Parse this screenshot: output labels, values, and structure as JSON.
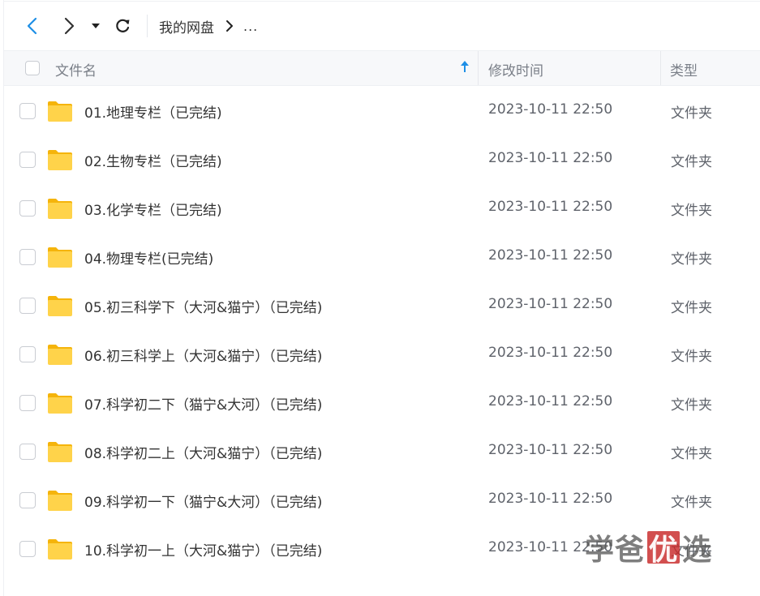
{
  "toolbar": {
    "back_icon": "chevron-left-icon",
    "forward_icon": "chevron-right-icon",
    "history_icon": "caret-down-icon",
    "refresh_icon": "refresh-icon",
    "accent_color": "#1e8fe6"
  },
  "breadcrumb": {
    "root": "我的网盘",
    "more": "..."
  },
  "table": {
    "columns": {
      "name": "文件名",
      "modified": "修改时间",
      "type": "类型"
    },
    "sort_icon": "arrow-up-icon",
    "rows": [
      {
        "name": "01.地理专栏（已完结)",
        "modified": "2023-10-11 22:50",
        "type": "文件夹"
      },
      {
        "name": "02.生物专栏（已完结)",
        "modified": "2023-10-11 22:50",
        "type": "文件夹"
      },
      {
        "name": "03.化学专栏（已完结)",
        "modified": "2023-10-11 22:50",
        "type": "文件夹"
      },
      {
        "name": "04.物理专栏(已完结)",
        "modified": "2023-10-11 22:50",
        "type": "文件夹"
      },
      {
        "name": "05.初三科学下（大河&猫宁）（已完结)",
        "modified": "2023-10-11 22:50",
        "type": "文件夹"
      },
      {
        "name": "06.初三科学上（大河&猫宁）（已完结)",
        "modified": "2023-10-11 22:50",
        "type": "文件夹"
      },
      {
        "name": "07.科学初二下（猫宁&大河）（已完结)",
        "modified": "2023-10-11 22:50",
        "type": "文件夹"
      },
      {
        "name": "08.科学初二上（大河&猫宁）（已完结)",
        "modified": "2023-10-11 22:50",
        "type": "文件夹"
      },
      {
        "name": "09.科学初一下（猫宁&大河）（已完结)",
        "modified": "2023-10-11 22:50",
        "type": "文件夹"
      },
      {
        "name": "10.科学初一上（大河&猫宁）（已完结)",
        "modified": "2023-10-11 22:50",
        "type": "文件夹"
      }
    ]
  },
  "watermark": {
    "part1": "学爸",
    "part2": "优",
    "part3": "选"
  }
}
